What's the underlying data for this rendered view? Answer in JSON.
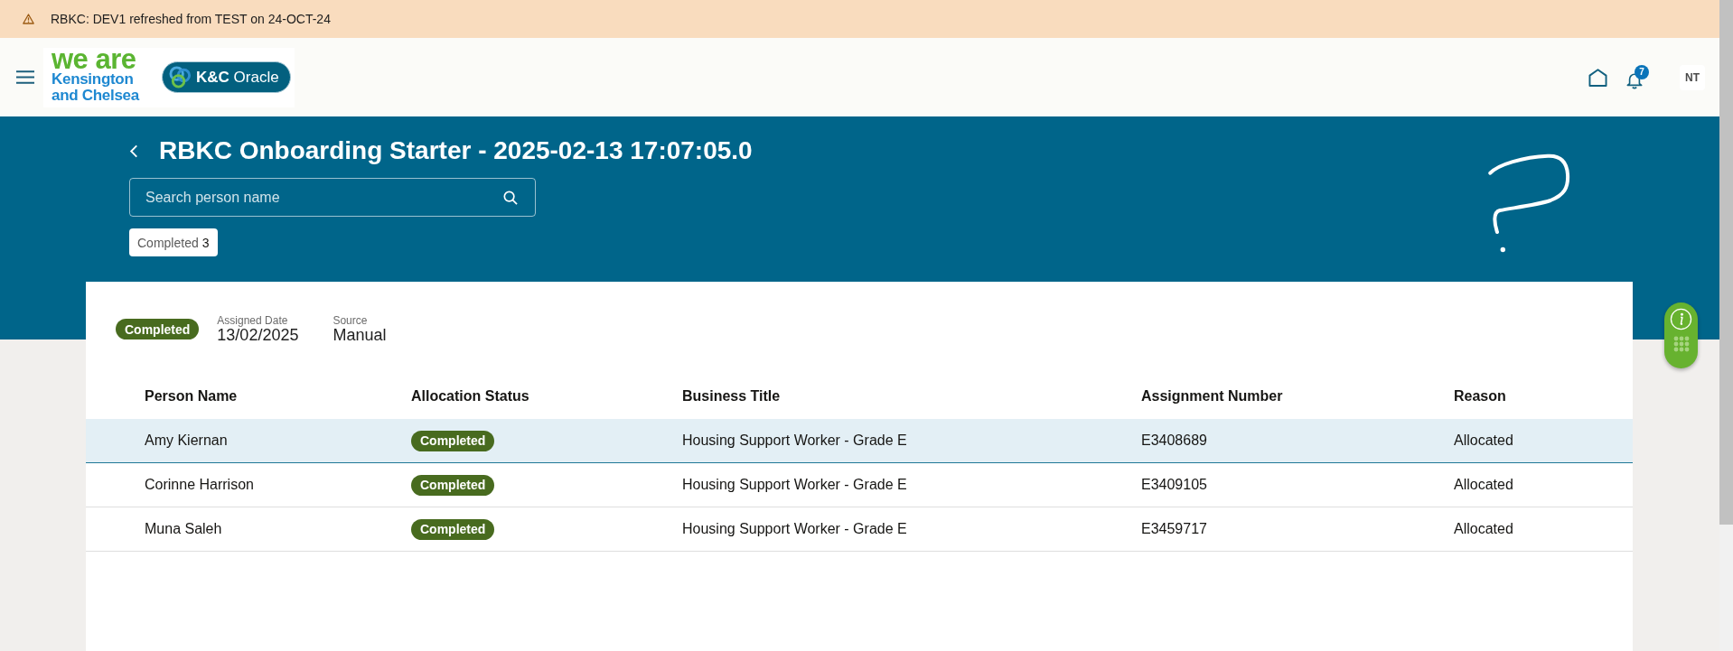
{
  "banner": {
    "text": "RBKC: DEV1 refreshed from TEST on 24-OCT-24"
  },
  "header": {
    "logo_lines": [
      "we are",
      "Kensington",
      "and Chelsea"
    ],
    "app_logo": "**K&C** Oracle",
    "notification_count": "7",
    "avatar_initials": "NT"
  },
  "page": {
    "title": "RBKC Onboarding Starter - 2025-02-13 17:07:05.0",
    "search": {
      "placeholder": "Search person name"
    },
    "filters": [
      {
        "label": "Completed",
        "count": "3"
      }
    ]
  },
  "summary": {
    "status": "Completed",
    "fields": [
      {
        "label": "Assigned Date",
        "value": "13/02/2025"
      },
      {
        "label": "Source",
        "value": "Manual"
      }
    ]
  },
  "table": {
    "columns": [
      {
        "label": "Person Name",
        "kind": "text"
      },
      {
        "label": "Allocation Status",
        "kind": "status"
      },
      {
        "label": "Business Title",
        "kind": "text"
      },
      {
        "label": "Assignment Number",
        "kind": "text"
      },
      {
        "label": "Reason",
        "kind": "text"
      }
    ],
    "rows": [
      {
        "cells": [
          "Amy Kiernan",
          "Completed",
          "Housing Support Worker - Grade E",
          "E3408689",
          "Allocated"
        ],
        "selected": true
      },
      {
        "cells": [
          "Corinne Harrison",
          "Completed",
          "Housing Support Worker - Grade E",
          "E3409105",
          "Allocated"
        ],
        "selected": false
      },
      {
        "cells": [
          "Muna Saleh",
          "Completed",
          "Housing Support Worker - Grade E",
          "E3459717",
          "Allocated"
        ],
        "selected": false
      }
    ]
  }
}
